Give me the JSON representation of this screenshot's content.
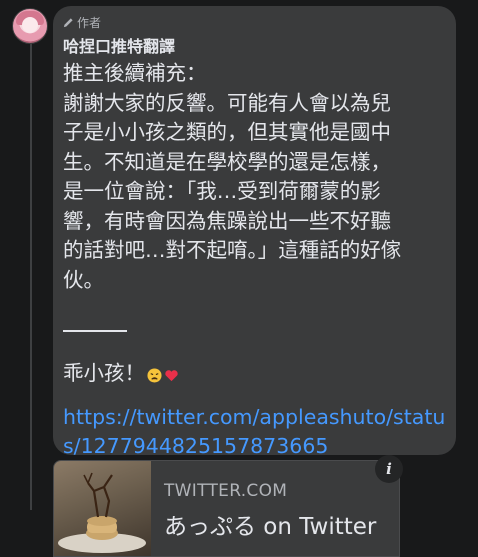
{
  "comment": {
    "author_badge": "作者",
    "author_name": "哈捏口推特翻譯",
    "lines": [
      "推主後續補充：",
      "謝謝大家的反響。可能有人會以為兒",
      "子是小小孩之類的，但其實他是國中",
      "生。不知道是在學校學的還是怎樣，",
      "是一位會說：「我…受到荷爾蒙的影",
      "響，有時會因為焦躁說出一些不好聽",
      "的話對吧…對不起唷。」這種話的好傢",
      "伙。"
    ],
    "closing_text": "乖小孩！",
    "emojis": [
      "tired-face-emoji",
      "heart-emoji"
    ],
    "link_lines": [
      "https://twitter.com/appleashuto/statu",
      "s/1277944825157873665"
    ]
  },
  "link_preview": {
    "domain": "TWITTER.COM",
    "title": "あっぷる on Twitter",
    "info_icon": "i"
  },
  "colors": {
    "background": "#18191a",
    "bubble": "#3a3b3c",
    "text": "#e4e6eb",
    "secondary_text": "#b0b3b8",
    "link": "#4599ff"
  }
}
